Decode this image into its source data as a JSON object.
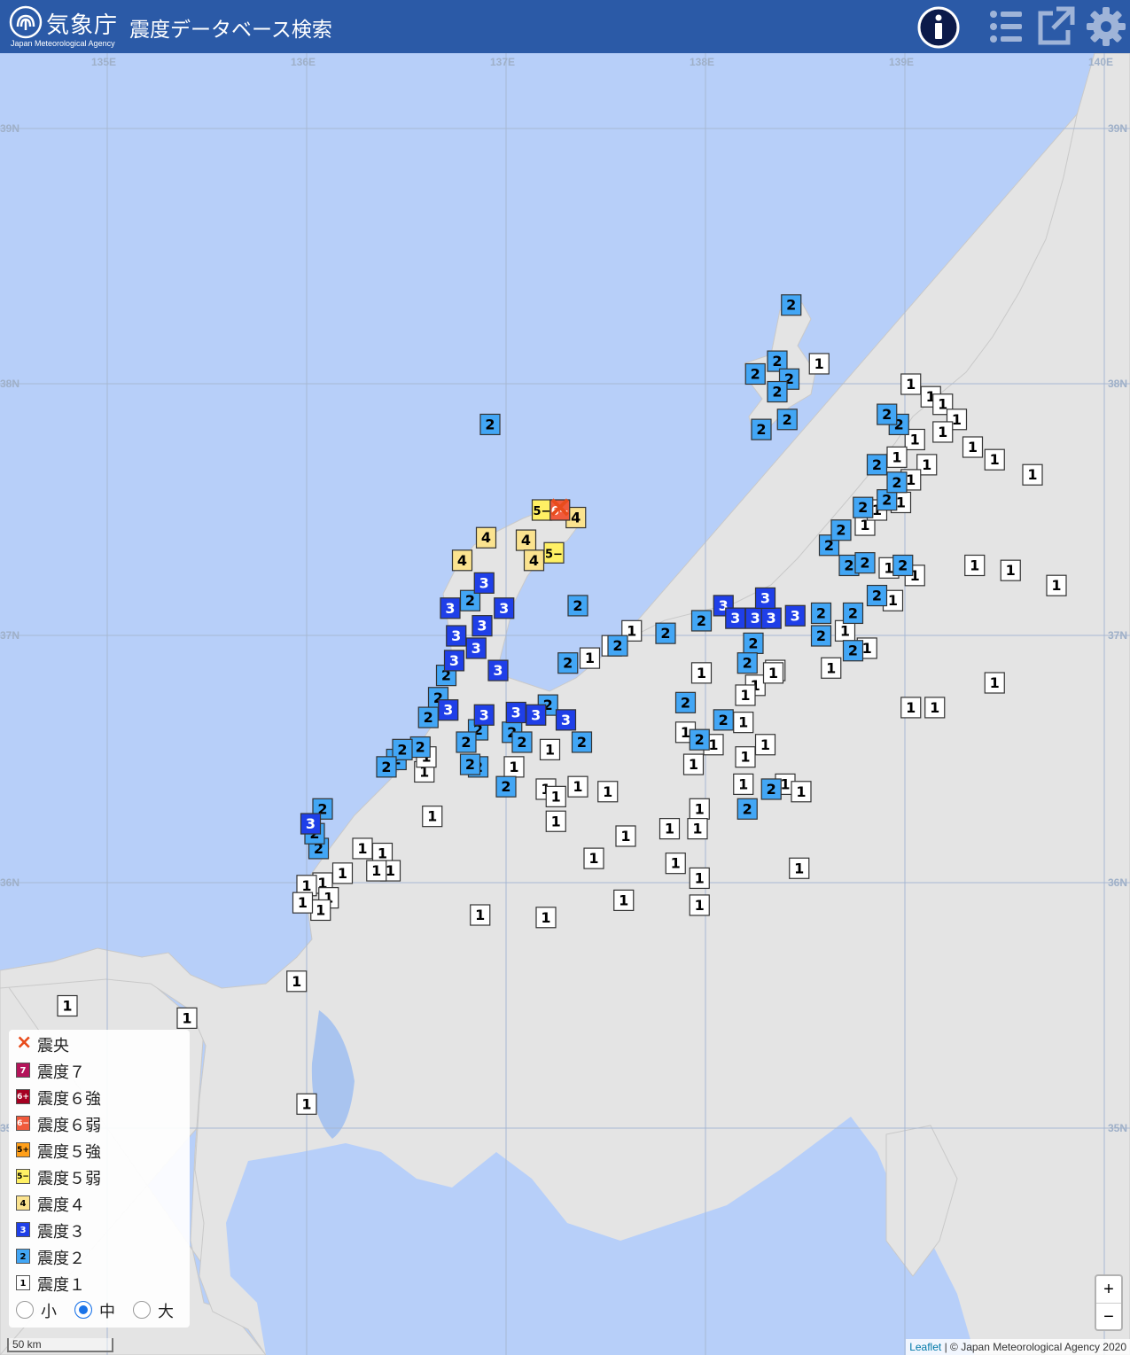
{
  "header": {
    "agency_name": "気象庁",
    "agency_sub": "Japan Meteorological Agency",
    "app_title": "震度データベース検索",
    "icons": [
      "info-icon",
      "list-icon",
      "external-link-icon",
      "gear-icon"
    ]
  },
  "map": {
    "longitude_labels": [
      "135E",
      "136E",
      "137E",
      "138E",
      "139E",
      "140E"
    ],
    "latitude_labels": [
      "39N",
      "38N",
      "37N",
      "36N",
      "35N"
    ],
    "epicenter": {
      "lon": 137.27,
      "lat": 37.5,
      "symbol": "×"
    },
    "colors": {
      "sea": "#b7cff9",
      "land": "#e6e6e6",
      "int1": "#ffffff",
      "int2": "#42a6f5",
      "int3": "#1f3fe8",
      "int4": "#fbe38f",
      "int5m": "#fff064",
      "int6m": "#f05a3c"
    },
    "stations": [
      {
        "lon": 137.27,
        "lat": 37.5,
        "i": "6-"
      },
      {
        "lon": 137.18,
        "lat": 37.5,
        "i": "5-"
      },
      {
        "lon": 137.24,
        "lat": 37.33,
        "i": "5-"
      },
      {
        "lon": 137.35,
        "lat": 37.47,
        "i": "4"
      },
      {
        "lon": 136.9,
        "lat": 37.39,
        "i": "4"
      },
      {
        "lon": 137.1,
        "lat": 37.38,
        "i": "4"
      },
      {
        "lon": 136.78,
        "lat": 37.3,
        "i": "4"
      },
      {
        "lon": 137.14,
        "lat": 37.3,
        "i": "4"
      },
      {
        "lon": 136.89,
        "lat": 37.21,
        "i": "3"
      },
      {
        "lon": 136.72,
        "lat": 37.11,
        "i": "3"
      },
      {
        "lon": 136.99,
        "lat": 37.11,
        "i": "3"
      },
      {
        "lon": 136.88,
        "lat": 37.04,
        "i": "3"
      },
      {
        "lon": 136.75,
        "lat": 37.0,
        "i": "3"
      },
      {
        "lon": 136.85,
        "lat": 36.95,
        "i": "3"
      },
      {
        "lon": 136.74,
        "lat": 36.9,
        "i": "3"
      },
      {
        "lon": 136.96,
        "lat": 36.86,
        "i": "3"
      },
      {
        "lon": 136.71,
        "lat": 36.7,
        "i": "3"
      },
      {
        "lon": 136.89,
        "lat": 36.68,
        "i": "3"
      },
      {
        "lon": 137.05,
        "lat": 36.69,
        "i": "3"
      },
      {
        "lon": 137.15,
        "lat": 36.68,
        "i": "3"
      },
      {
        "lon": 137.3,
        "lat": 36.66,
        "i": "3"
      },
      {
        "lon": 138.09,
        "lat": 37.12,
        "i": "3"
      },
      {
        "lon": 138.15,
        "lat": 37.07,
        "i": "3"
      },
      {
        "lon": 138.25,
        "lat": 37.07,
        "i": "3"
      },
      {
        "lon": 138.33,
        "lat": 37.07,
        "i": "3"
      },
      {
        "lon": 138.45,
        "lat": 37.08,
        "i": "3"
      },
      {
        "lon": 138.3,
        "lat": 37.15,
        "i": "3"
      },
      {
        "lon": 136.02,
        "lat": 36.24,
        "i": "3"
      },
      {
        "lon": 138.43,
        "lat": 38.31,
        "i": "2"
      },
      {
        "lon": 138.25,
        "lat": 38.04,
        "i": "2"
      },
      {
        "lon": 138.36,
        "lat": 38.09,
        "i": "2"
      },
      {
        "lon": 138.42,
        "lat": 38.02,
        "i": "2"
      },
      {
        "lon": 138.36,
        "lat": 37.97,
        "i": "2"
      },
      {
        "lon": 138.41,
        "lat": 37.86,
        "i": "2"
      },
      {
        "lon": 138.28,
        "lat": 37.82,
        "i": "2"
      },
      {
        "lon": 136.92,
        "lat": 37.84,
        "i": "2"
      },
      {
        "lon": 136.82,
        "lat": 37.14,
        "i": "2"
      },
      {
        "lon": 136.7,
        "lat": 36.84,
        "i": "2"
      },
      {
        "lon": 136.66,
        "lat": 36.75,
        "i": "2"
      },
      {
        "lon": 136.61,
        "lat": 36.67,
        "i": "2"
      },
      {
        "lon": 136.57,
        "lat": 36.55,
        "i": "2"
      },
      {
        "lon": 136.45,
        "lat": 36.5,
        "i": "2"
      },
      {
        "lon": 136.48,
        "lat": 36.54,
        "i": "2"
      },
      {
        "lon": 136.4,
        "lat": 36.47,
        "i": "2"
      },
      {
        "lon": 136.08,
        "lat": 36.3,
        "i": "2"
      },
      {
        "lon": 136.06,
        "lat": 36.14,
        "i": "2"
      },
      {
        "lon": 136.04,
        "lat": 36.2,
        "i": "2"
      },
      {
        "lon": 136.86,
        "lat": 36.62,
        "i": "2"
      },
      {
        "lon": 136.8,
        "lat": 36.57,
        "i": "2"
      },
      {
        "lon": 136.86,
        "lat": 36.47,
        "i": "2"
      },
      {
        "lon": 137.03,
        "lat": 36.61,
        "i": "2"
      },
      {
        "lon": 137.08,
        "lat": 36.57,
        "i": "2"
      },
      {
        "lon": 137.21,
        "lat": 36.72,
        "i": "2"
      },
      {
        "lon": 137.38,
        "lat": 36.57,
        "i": "2"
      },
      {
        "lon": 137.31,
        "lat": 36.89,
        "i": "2"
      },
      {
        "lon": 137.56,
        "lat": 36.96,
        "i": "2"
      },
      {
        "lon": 137.8,
        "lat": 37.01,
        "i": "2"
      },
      {
        "lon": 137.98,
        "lat": 37.06,
        "i": "2"
      },
      {
        "lon": 137.9,
        "lat": 36.73,
        "i": "2"
      },
      {
        "lon": 138.09,
        "lat": 36.66,
        "i": "2"
      },
      {
        "lon": 137.97,
        "lat": 36.58,
        "i": "2"
      },
      {
        "lon": 138.24,
        "lat": 36.97,
        "i": "2"
      },
      {
        "lon": 138.21,
        "lat": 36.89,
        "i": "2"
      },
      {
        "lon": 138.58,
        "lat": 37.0,
        "i": "2"
      },
      {
        "lon": 138.58,
        "lat": 37.09,
        "i": "2"
      },
      {
        "lon": 138.74,
        "lat": 37.09,
        "i": "2"
      },
      {
        "lon": 138.86,
        "lat": 37.16,
        "i": "2"
      },
      {
        "lon": 138.72,
        "lat": 37.28,
        "i": "2"
      },
      {
        "lon": 138.8,
        "lat": 37.29,
        "i": "2"
      },
      {
        "lon": 138.62,
        "lat": 37.36,
        "i": "2"
      },
      {
        "lon": 138.68,
        "lat": 37.42,
        "i": "2"
      },
      {
        "lon": 138.79,
        "lat": 37.51,
        "i": "2"
      },
      {
        "lon": 138.91,
        "lat": 37.54,
        "i": "2"
      },
      {
        "lon": 138.86,
        "lat": 37.68,
        "i": "2"
      },
      {
        "lon": 138.97,
        "lat": 37.84,
        "i": "2"
      },
      {
        "lon": 138.74,
        "lat": 36.94,
        "i": "2"
      },
      {
        "lon": 138.21,
        "lat": 36.3,
        "i": "2"
      },
      {
        "lon": 138.33,
        "lat": 36.38,
        "i": "2"
      },
      {
        "lon": 137.0,
        "lat": 36.39,
        "i": "2"
      },
      {
        "lon": 138.99,
        "lat": 37.28,
        "i": "2"
      },
      {
        "lon": 136.82,
        "lat": 36.48,
        "i": "2"
      },
      {
        "lon": 137.36,
        "lat": 37.12,
        "i": "2"
      },
      {
        "lon": 138.96,
        "lat": 37.61,
        "i": "2"
      },
      {
        "lon": 138.91,
        "lat": 37.88,
        "i": "2"
      },
      {
        "lon": 139.03,
        "lat": 38.0,
        "i": "1"
      },
      {
        "lon": 139.13,
        "lat": 37.95,
        "i": "1"
      },
      {
        "lon": 139.19,
        "lat": 37.92,
        "i": "1"
      },
      {
        "lon": 139.26,
        "lat": 37.86,
        "i": "1"
      },
      {
        "lon": 139.19,
        "lat": 37.81,
        "i": "1"
      },
      {
        "lon": 139.05,
        "lat": 37.78,
        "i": "1"
      },
      {
        "lon": 139.11,
        "lat": 37.68,
        "i": "1"
      },
      {
        "lon": 138.96,
        "lat": 37.71,
        "i": "1"
      },
      {
        "lon": 139.34,
        "lat": 37.75,
        "i": "1"
      },
      {
        "lon": 139.45,
        "lat": 37.7,
        "i": "1"
      },
      {
        "lon": 139.64,
        "lat": 37.64,
        "i": "1"
      },
      {
        "lon": 139.03,
        "lat": 37.62,
        "i": "1"
      },
      {
        "lon": 138.98,
        "lat": 37.53,
        "i": "1"
      },
      {
        "lon": 138.8,
        "lat": 37.44,
        "i": "1"
      },
      {
        "lon": 138.86,
        "lat": 37.5,
        "i": "1"
      },
      {
        "lon": 138.92,
        "lat": 37.27,
        "i": "1"
      },
      {
        "lon": 139.05,
        "lat": 37.24,
        "i": "1"
      },
      {
        "lon": 138.94,
        "lat": 37.14,
        "i": "1"
      },
      {
        "lon": 138.7,
        "lat": 37.02,
        "i": "1"
      },
      {
        "lon": 138.81,
        "lat": 36.95,
        "i": "1"
      },
      {
        "lon": 139.35,
        "lat": 37.28,
        "i": "1"
      },
      {
        "lon": 139.53,
        "lat": 37.26,
        "i": "1"
      },
      {
        "lon": 139.76,
        "lat": 37.2,
        "i": "1"
      },
      {
        "lon": 139.45,
        "lat": 36.81,
        "i": "1"
      },
      {
        "lon": 139.03,
        "lat": 36.71,
        "i": "1"
      },
      {
        "lon": 139.15,
        "lat": 36.71,
        "i": "1"
      },
      {
        "lon": 138.63,
        "lat": 36.87,
        "i": "1"
      },
      {
        "lon": 138.35,
        "lat": 36.86,
        "i": "1"
      },
      {
        "lon": 138.25,
        "lat": 36.8,
        "i": "1"
      },
      {
        "lon": 138.2,
        "lat": 36.76,
        "i": "1"
      },
      {
        "lon": 138.19,
        "lat": 36.65,
        "i": "1"
      },
      {
        "lon": 138.3,
        "lat": 36.56,
        "i": "1"
      },
      {
        "lon": 138.2,
        "lat": 36.51,
        "i": "1"
      },
      {
        "lon": 138.04,
        "lat": 36.56,
        "i": "1"
      },
      {
        "lon": 137.9,
        "lat": 36.61,
        "i": "1"
      },
      {
        "lon": 137.94,
        "lat": 36.48,
        "i": "1"
      },
      {
        "lon": 138.19,
        "lat": 36.4,
        "i": "1"
      },
      {
        "lon": 138.4,
        "lat": 36.4,
        "i": "1"
      },
      {
        "lon": 138.48,
        "lat": 36.37,
        "i": "1"
      },
      {
        "lon": 137.97,
        "lat": 36.3,
        "i": "1"
      },
      {
        "lon": 137.96,
        "lat": 36.22,
        "i": "1"
      },
      {
        "lon": 137.82,
        "lat": 36.22,
        "i": "1"
      },
      {
        "lon": 137.85,
        "lat": 36.08,
        "i": "1"
      },
      {
        "lon": 137.97,
        "lat": 36.02,
        "i": "1"
      },
      {
        "lon": 138.47,
        "lat": 36.06,
        "i": "1"
      },
      {
        "lon": 137.6,
        "lat": 36.19,
        "i": "1"
      },
      {
        "lon": 137.44,
        "lat": 36.1,
        "i": "1"
      },
      {
        "lon": 137.2,
        "lat": 36.38,
        "i": "1"
      },
      {
        "lon": 137.36,
        "lat": 36.39,
        "i": "1"
      },
      {
        "lon": 137.51,
        "lat": 36.37,
        "i": "1"
      },
      {
        "lon": 137.25,
        "lat": 36.35,
        "i": "1"
      },
      {
        "lon": 137.25,
        "lat": 36.25,
        "i": "1"
      },
      {
        "lon": 137.04,
        "lat": 36.47,
        "i": "1"
      },
      {
        "lon": 137.22,
        "lat": 36.54,
        "i": "1"
      },
      {
        "lon": 137.42,
        "lat": 36.91,
        "i": "1"
      },
      {
        "lon": 137.53,
        "lat": 36.96,
        "i": "1"
      },
      {
        "lon": 137.63,
        "lat": 37.02,
        "i": "1"
      },
      {
        "lon": 136.59,
        "lat": 36.45,
        "i": "1"
      },
      {
        "lon": 136.6,
        "lat": 36.51,
        "i": "1"
      },
      {
        "lon": 136.63,
        "lat": 36.27,
        "i": "1"
      },
      {
        "lon": 136.28,
        "lat": 36.14,
        "i": "1"
      },
      {
        "lon": 136.38,
        "lat": 36.12,
        "i": "1"
      },
      {
        "lon": 136.42,
        "lat": 36.05,
        "i": "1"
      },
      {
        "lon": 136.35,
        "lat": 36.05,
        "i": "1"
      },
      {
        "lon": 136.18,
        "lat": 36.04,
        "i": "1"
      },
      {
        "lon": 136.08,
        "lat": 36.0,
        "i": "1"
      },
      {
        "lon": 136.0,
        "lat": 35.99,
        "i": "1"
      },
      {
        "lon": 136.11,
        "lat": 35.94,
        "i": "1"
      },
      {
        "lon": 136.07,
        "lat": 35.89,
        "i": "1"
      },
      {
        "lon": 135.98,
        "lat": 35.92,
        "i": "1"
      },
      {
        "lon": 136.87,
        "lat": 35.87,
        "i": "1"
      },
      {
        "lon": 137.2,
        "lat": 35.86,
        "i": "1"
      },
      {
        "lon": 137.59,
        "lat": 35.93,
        "i": "1"
      },
      {
        "lon": 137.97,
        "lat": 35.91,
        "i": "1"
      },
      {
        "lon": 135.95,
        "lat": 35.6,
        "i": "1"
      },
      {
        "lon": 134.8,
        "lat": 35.5,
        "i": "1"
      },
      {
        "lon": 135.4,
        "lat": 35.45,
        "i": "1"
      },
      {
        "lon": 136.0,
        "lat": 35.1,
        "i": "1"
      },
      {
        "lon": 138.57,
        "lat": 38.08,
        "i": "1"
      },
      {
        "lon": 137.98,
        "lat": 36.85,
        "i": "1"
      },
      {
        "lon": 138.34,
        "lat": 36.85,
        "i": "1"
      }
    ]
  },
  "legend": {
    "items": [
      {
        "badge": "×",
        "label": "震央",
        "color": "#e84c1c",
        "kind": "epicenter"
      },
      {
        "badge": "7",
        "label": "震度７",
        "color": "#b4145a"
      },
      {
        "badge": "6+",
        "label": "震度６強",
        "color": "#a50021"
      },
      {
        "badge": "6−",
        "label": "震度６弱",
        "color": "#f05a3c"
      },
      {
        "badge": "5+",
        "label": "震度５強",
        "color": "#ff9f1a"
      },
      {
        "badge": "5−",
        "label": "震度５弱",
        "color": "#fff064"
      },
      {
        "badge": "4",
        "label": "震度４",
        "color": "#fbe38f"
      },
      {
        "badge": "3",
        "label": "震度３",
        "color": "#1f3fe8"
      },
      {
        "badge": "2",
        "label": "震度２",
        "color": "#42a6f5"
      },
      {
        "badge": "1",
        "label": "震度１",
        "color": "#ffffff"
      }
    ],
    "size_options": [
      {
        "label": "小",
        "selected": false
      },
      {
        "label": "中",
        "selected": true
      },
      {
        "label": "大",
        "selected": false
      }
    ]
  },
  "controls": {
    "zoom_in": "+",
    "zoom_out": "−"
  },
  "scale_bar": "50 km",
  "attribution": {
    "leaflet": "Leaflet",
    "text": " | © Japan Meteorological Agency 2020"
  }
}
